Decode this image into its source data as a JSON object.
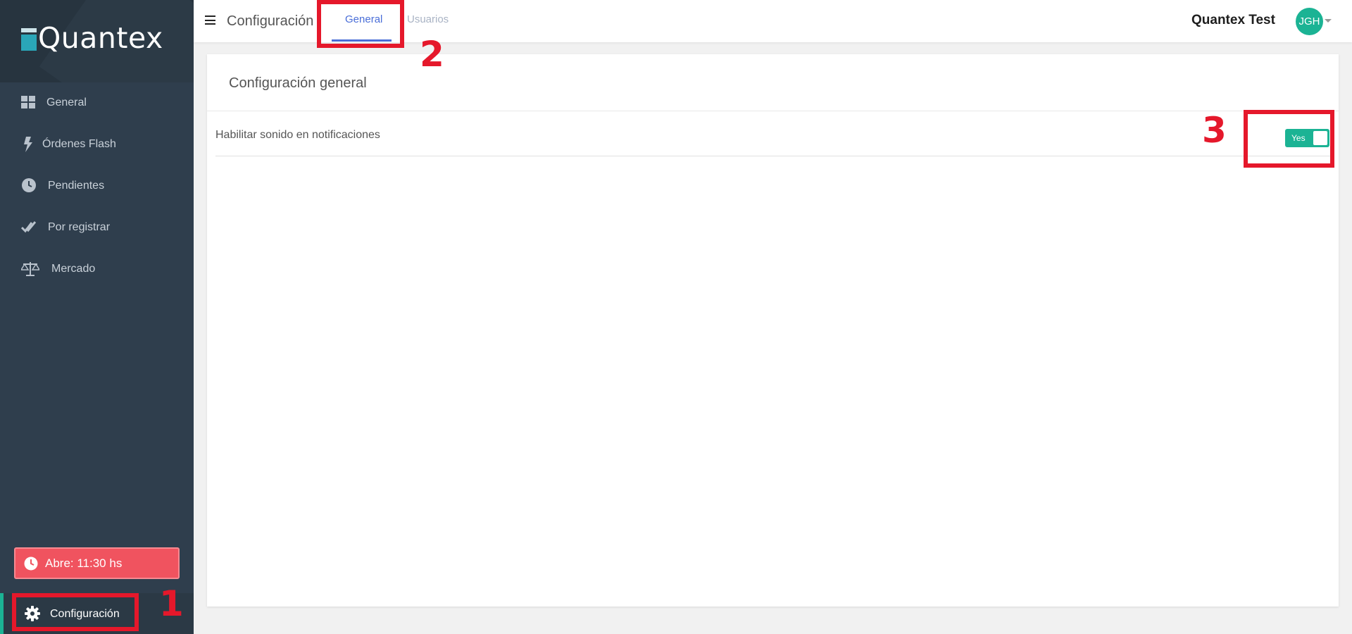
{
  "brand": {
    "name": "Quantex"
  },
  "sidebar": {
    "items": [
      {
        "label": "General",
        "icon": "grid-icon"
      },
      {
        "label": "Órdenes Flash",
        "icon": "bolt-icon"
      },
      {
        "label": "Pendientes",
        "icon": "clock-icon"
      },
      {
        "label": "Por registrar",
        "icon": "double-check-icon"
      },
      {
        "label": "Mercado",
        "icon": "scale-icon"
      }
    ],
    "open_time": "Abre: 11:30 hs",
    "config_label": "Configuración"
  },
  "header": {
    "title": "Configuración",
    "tabs": [
      {
        "label": "General",
        "active": true
      },
      {
        "label": "Usuarios",
        "active": false
      }
    ],
    "account_name": "Quantex Test",
    "avatar_initials": "JGH"
  },
  "main": {
    "card_title": "Configuración general",
    "settings": [
      {
        "label": "Habilitar sonido en notificaciones",
        "toggle_text": "Yes",
        "enabled": true
      }
    ]
  },
  "annotations": [
    "1",
    "2",
    "3"
  ],
  "colors": {
    "sidebar_bg": "#2f3e4d",
    "accent_green": "#1bb394",
    "alert_red": "#f0535f",
    "tab_blue": "#4a6ed8",
    "annotation_red": "#e5182b"
  }
}
